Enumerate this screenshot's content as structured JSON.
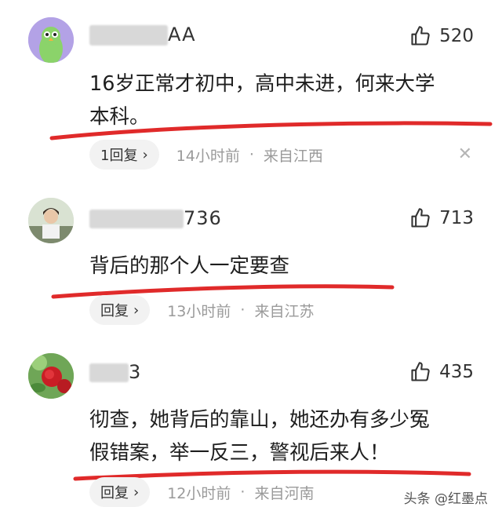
{
  "comments": [
    {
      "username_visible": "AA",
      "likes": "520",
      "text_line1": "16岁正常才初中，高中未进，何来大学",
      "text_line2": "本科。",
      "reply_label": "1回复",
      "time": "14小时前",
      "separator": "·",
      "location": "来自江西"
    },
    {
      "username_visible": "736",
      "likes": "713",
      "text_line1": "背后的那个人一定要查",
      "reply_label": "回复",
      "time": "13小时前",
      "separator": "·",
      "location": "来自江苏"
    },
    {
      "username_visible": "3",
      "likes": "435",
      "text_line1": "彻查，她背后的靠山，她还办有多少冤",
      "text_line2": "假错案，举一反三，警视后来人！",
      "reply_label": "回复",
      "time": "12小时前",
      "separator": "·",
      "location": "来自河南"
    }
  ],
  "icons": {
    "like": "thumbs-up-icon",
    "chevron": "chevron-right-icon",
    "close": "close-icon"
  },
  "watermark": "头条 @红墨点",
  "colors": {
    "underline": "#e02a2a",
    "meta": "#9a9a9a"
  }
}
